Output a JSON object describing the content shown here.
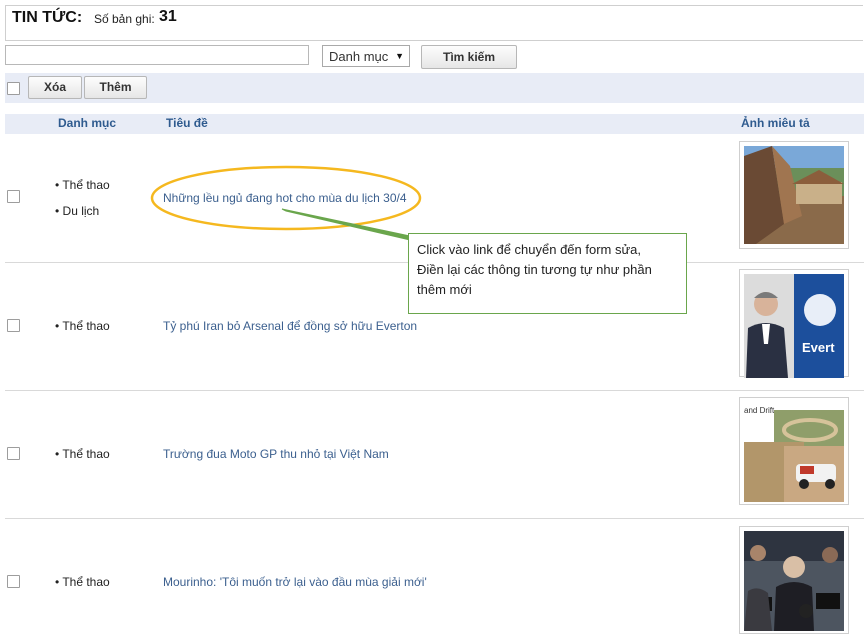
{
  "header": {
    "title": "TIN TỨC:",
    "count_label": "Số bản ghi:",
    "count_value": "31"
  },
  "search": {
    "value": "",
    "placeholder": "",
    "category_selected": "Danh mục",
    "button_label": "Tìm kiếm"
  },
  "toolbar": {
    "delete_label": "Xóa",
    "add_label": "Thêm"
  },
  "table": {
    "columns": {
      "category": "Danh mục",
      "title": "Tiêu đề",
      "image": "Ảnh miêu tả"
    },
    "rows": [
      {
        "categories": [
          "Thể thao",
          "Du lịch"
        ],
        "title": "Những lều ngủ đang hot cho mùa du lịch 30/4",
        "image": "tent-photo"
      },
      {
        "categories": [
          "Thể thao"
        ],
        "title": "Tỷ phú Iran bỏ Arsenal để đồng sở hữu Everton",
        "image": "everton-photo"
      },
      {
        "categories": [
          "Thể thao"
        ],
        "title": "Trường đua Moto GP thu nhỏ tại Việt Nam",
        "image": "race-track-photo"
      },
      {
        "categories": [
          "Thể thao"
        ],
        "title": "Mourinho: 'Tôi muốn trở lại vào đầu mùa giải mới'",
        "image": "mourinho-photo"
      }
    ]
  },
  "annotation": {
    "lines": [
      "Click vào link để chuyển đến form sửa,",
      "Điền lại các thông tin tương tự như phần",
      "thêm mới"
    ],
    "highlight_color": "#f5b81f",
    "border_color": "#6aa64c"
  },
  "colors": {
    "accent": "#3b5f8e",
    "header_bg": "#e8ecf6",
    "column_header": "#2f5b8f"
  },
  "thumb_snippet_text": "and Drift"
}
